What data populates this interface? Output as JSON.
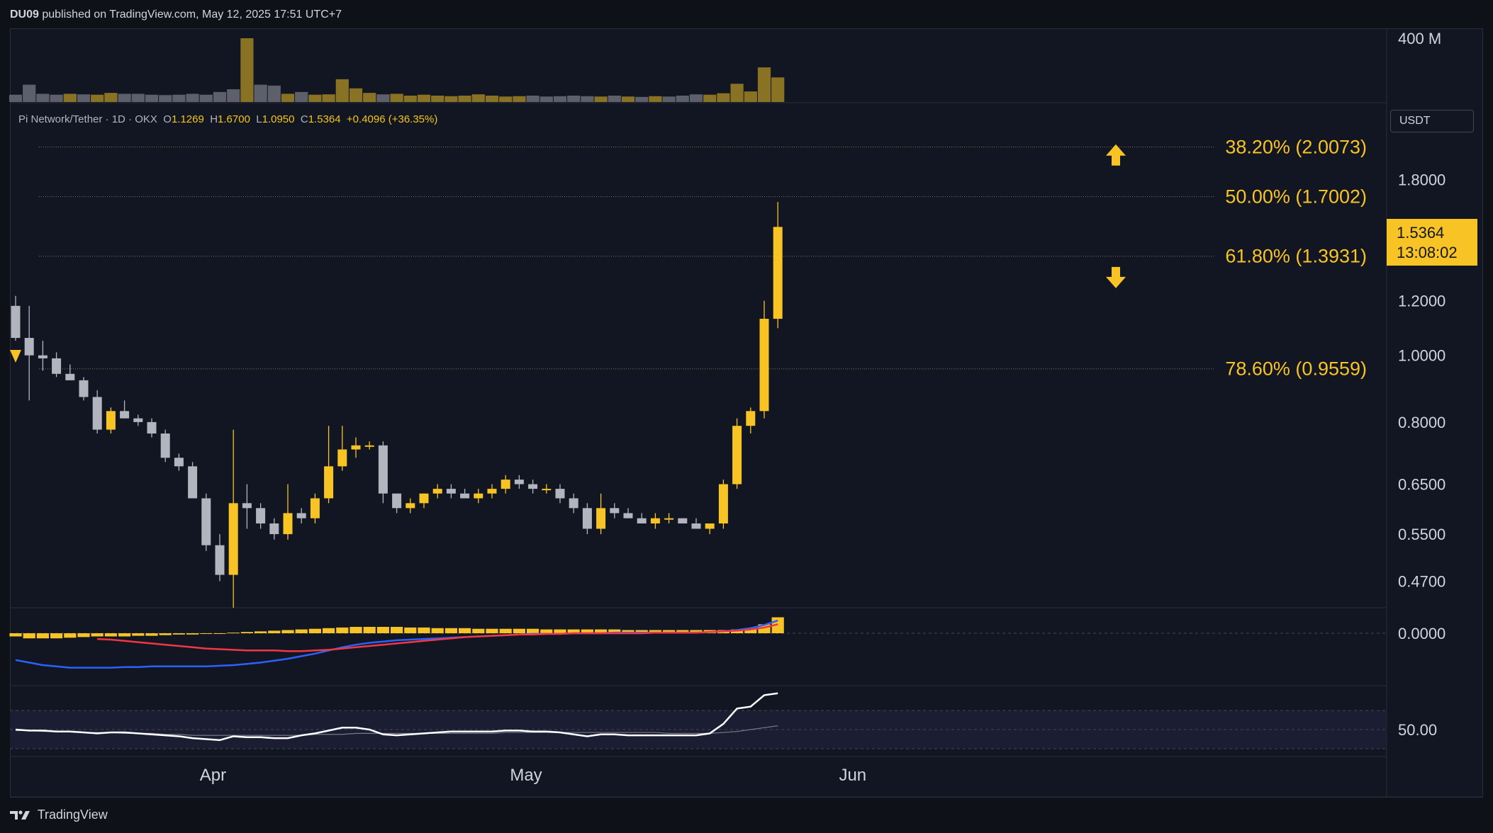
{
  "header": {
    "publisher": "DU09",
    "published_text": "published on TradingView.com, May 12, 2025 17:51 UTC+7"
  },
  "symbol": {
    "name": "Pi Network/Tether",
    "interval": "1D",
    "exchange": "OKX",
    "o_label": "O",
    "o_value": "1.1269",
    "h_label": "H",
    "h_value": "1.6700",
    "l_label": "L",
    "l_value": "1.0950",
    "c_label": "C",
    "c_value": "1.5364",
    "change": "+0.4096 (+36.35%)"
  },
  "currency": "USDT",
  "last_price": {
    "price": "1.5364",
    "countdown": "13:08:02"
  },
  "footer": {
    "brand": "TradingView"
  },
  "colors": {
    "up": "#f7c325",
    "down": "#b2b5be",
    "volume_up": "#8a7224",
    "volume_down": "#5d606b",
    "macd_line": "#2962ff",
    "signal_line": "#f23645",
    "rsi_line": "#ffffff",
    "fib": "#f7c325"
  },
  "chart_data": [
    {
      "type": "candlestick",
      "title": "Pi Network/Tether · 1D · OKX",
      "x_tick_labels": [
        "Apr",
        "May",
        "Jun"
      ],
      "y_scale": "log",
      "y_tick_labels": [
        "1.8000",
        "1.2000",
        "1.0000",
        "0.8000",
        "0.6500",
        "0.5500",
        "0.4700"
      ],
      "y_ticks": [
        1.8,
        1.2,
        1.0,
        0.8,
        0.65,
        0.55,
        0.47
      ],
      "ylim": [
        0.43,
        2.3
      ],
      "fib_levels": [
        {
          "label": "38.20% (2.0073)",
          "value": 2.0073
        },
        {
          "label": "50.00% (1.7002)",
          "value": 1.7002
        },
        {
          "label": "61.80% (1.3931)",
          "value": 1.3931
        },
        {
          "label": "78.60% (0.9559)",
          "value": 0.9559
        }
      ],
      "annotations": [
        {
          "type": "arrow-up",
          "price": 1.95
        },
        {
          "type": "arrow-down",
          "price": 1.3
        }
      ],
      "candles": [
        [
          1.18,
          1.22,
          1.05,
          1.06
        ],
        [
          1.06,
          1.18,
          0.86,
          1.0
        ],
        [
          1.0,
          1.05,
          0.95,
          0.99
        ],
        [
          0.99,
          1.01,
          0.93,
          0.94
        ],
        [
          0.94,
          0.97,
          0.92,
          0.92
        ],
        [
          0.92,
          0.93,
          0.86,
          0.87
        ],
        [
          0.87,
          0.89,
          0.77,
          0.78
        ],
        [
          0.78,
          0.84,
          0.77,
          0.83
        ],
        [
          0.83,
          0.86,
          0.81,
          0.81
        ],
        [
          0.81,
          0.82,
          0.79,
          0.8
        ],
        [
          0.8,
          0.81,
          0.76,
          0.77
        ],
        [
          0.77,
          0.78,
          0.7,
          0.71
        ],
        [
          0.71,
          0.72,
          0.68,
          0.69
        ],
        [
          0.69,
          0.7,
          0.62,
          0.62
        ],
        [
          0.62,
          0.63,
          0.52,
          0.53
        ],
        [
          0.53,
          0.55,
          0.47,
          0.48
        ],
        [
          0.48,
          0.78,
          0.43,
          0.61
        ],
        [
          0.61,
          0.65,
          0.56,
          0.6
        ],
        [
          0.6,
          0.61,
          0.56,
          0.57
        ],
        [
          0.57,
          0.58,
          0.54,
          0.55
        ],
        [
          0.55,
          0.65,
          0.54,
          0.59
        ],
        [
          0.59,
          0.6,
          0.57,
          0.58
        ],
        [
          0.58,
          0.63,
          0.57,
          0.62
        ],
        [
          0.62,
          0.79,
          0.61,
          0.69
        ],
        [
          0.69,
          0.79,
          0.68,
          0.73
        ],
        [
          0.73,
          0.76,
          0.71,
          0.74
        ],
        [
          0.74,
          0.75,
          0.73,
          0.74
        ],
        [
          0.74,
          0.75,
          0.61,
          0.63
        ],
        [
          0.63,
          0.63,
          0.59,
          0.6
        ],
        [
          0.6,
          0.62,
          0.59,
          0.61
        ],
        [
          0.61,
          0.63,
          0.6,
          0.63
        ],
        [
          0.63,
          0.65,
          0.62,
          0.64
        ],
        [
          0.64,
          0.65,
          0.62,
          0.63
        ],
        [
          0.63,
          0.64,
          0.62,
          0.62
        ],
        [
          0.62,
          0.64,
          0.61,
          0.63
        ],
        [
          0.63,
          0.65,
          0.62,
          0.64
        ],
        [
          0.64,
          0.67,
          0.63,
          0.66
        ],
        [
          0.66,
          0.67,
          0.64,
          0.65
        ],
        [
          0.65,
          0.66,
          0.63,
          0.64
        ],
        [
          0.64,
          0.65,
          0.63,
          0.64
        ],
        [
          0.64,
          0.65,
          0.61,
          0.62
        ],
        [
          0.62,
          0.63,
          0.59,
          0.6
        ],
        [
          0.6,
          0.61,
          0.55,
          0.56
        ],
        [
          0.56,
          0.63,
          0.55,
          0.6
        ],
        [
          0.6,
          0.61,
          0.58,
          0.59
        ],
        [
          0.59,
          0.6,
          0.58,
          0.58
        ],
        [
          0.58,
          0.59,
          0.57,
          0.57
        ],
        [
          0.57,
          0.59,
          0.56,
          0.58
        ],
        [
          0.58,
          0.59,
          0.57,
          0.58
        ],
        [
          0.58,
          0.58,
          0.57,
          0.57
        ],
        [
          0.57,
          0.58,
          0.56,
          0.56
        ],
        [
          0.56,
          0.57,
          0.55,
          0.57
        ],
        [
          0.57,
          0.66,
          0.56,
          0.65
        ],
        [
          0.65,
          0.81,
          0.64,
          0.79
        ],
        [
          0.79,
          0.84,
          0.77,
          0.83
        ],
        [
          0.83,
          1.2,
          0.81,
          1.13
        ],
        [
          1.13,
          1.67,
          1.095,
          1.5364
        ]
      ]
    },
    {
      "type": "bar",
      "title": "Volume",
      "y_tick_labels": [
        "400 M"
      ],
      "values": [
        40,
        95,
        45,
        40,
        45,
        42,
        40,
        50,
        45,
        45,
        40,
        38,
        40,
        45,
        40,
        55,
        70,
        350,
        95,
        90,
        45,
        55,
        40,
        42,
        125,
        75,
        50,
        42,
        45,
        35,
        40,
        35,
        32,
        35,
        42,
        35,
        30,
        32,
        35,
        30,
        32,
        35,
        32,
        30,
        35,
        30,
        28,
        32,
        30,
        35,
        42,
        40,
        48,
        100,
        58,
        190,
        135
      ],
      "up": [
        0,
        0,
        0,
        0,
        1,
        0,
        1,
        1,
        0,
        0,
        0,
        0,
        0,
        0,
        0,
        0,
        0,
        1,
        0,
        0,
        1,
        0,
        1,
        1,
        1,
        1,
        1,
        0,
        1,
        1,
        1,
        1,
        1,
        1,
        1,
        1,
        1,
        1,
        0,
        0,
        0,
        0,
        0,
        1,
        0,
        1,
        0,
        1,
        0,
        0,
        0,
        1,
        1,
        1,
        1,
        1,
        1
      ]
    },
    {
      "type": "bar",
      "title": "MACD",
      "y_tick_labels": [
        "0.0000"
      ],
      "histogram": [
        -5,
        -8,
        -8,
        -8,
        -7,
        -6,
        -5,
        -5,
        -5,
        -4,
        -4,
        -3,
        -2,
        -2,
        -1,
        0,
        1,
        2,
        3,
        4,
        5,
        6,
        7,
        8,
        9,
        10,
        10,
        10,
        10,
        9,
        9,
        8,
        8,
        8,
        7,
        7,
        7,
        7,
        7,
        6,
        6,
        6,
        6,
        6,
        6,
        5,
        5,
        5,
        5,
        5,
        5,
        5,
        5,
        6,
        8,
        14,
        25
      ],
      "series": [
        {
          "values": [
            -42,
            -46,
            -50,
            -52,
            -54,
            -54,
            -54,
            -54,
            -53,
            -53,
            -52,
            -52,
            -52,
            -52,
            -52,
            -51,
            -50,
            -48,
            -46,
            -43,
            -40,
            -36,
            -32,
            -27,
            -22,
            -18,
            -15,
            -13,
            -11,
            -10,
            -9,
            -8,
            -7,
            -6,
            -5,
            -4,
            -3,
            -2,
            -1,
            -1,
            -1,
            0,
            0,
            0,
            1,
            1,
            1,
            1,
            1,
            1,
            1,
            2,
            3,
            5,
            8,
            13,
            20
          ]
        },
        {
          "values": [
            null,
            null,
            null,
            null,
            null,
            null,
            -9,
            -10,
            -12,
            -14,
            -16,
            -18,
            -20,
            -22,
            -24,
            -25,
            -26,
            -27,
            -27,
            -27,
            -28,
            -28,
            -27,
            -26,
            -24,
            -22,
            -20,
            -18,
            -16,
            -14,
            -12,
            -10,
            -8,
            -6,
            -5,
            -4,
            -3,
            -2,
            -2,
            -1,
            -1,
            0,
            0,
            0,
            0,
            0,
            0,
            1,
            1,
            1,
            1,
            2,
            3,
            4,
            6,
            9,
            14
          ]
        }
      ]
    },
    {
      "type": "line",
      "title": "RSI",
      "y_tick_labels": [
        "50.00"
      ],
      "series": [
        {
          "values": [
            50,
            49,
            49,
            48,
            48,
            47,
            46,
            47,
            47,
            46,
            45,
            44,
            43,
            41,
            40,
            39,
            43,
            42,
            42,
            41,
            41,
            44,
            46,
            49,
            52,
            52,
            50,
            45,
            44,
            45,
            46,
            47,
            48,
            48,
            48,
            48,
            49,
            49,
            48,
            48,
            47,
            45,
            43,
            45,
            45,
            44,
            44,
            44,
            44,
            44,
            44,
            46,
            56,
            72,
            74,
            86,
            88
          ]
        },
        {
          "values": [
            49,
            49,
            48,
            48,
            48,
            47,
            47,
            47,
            46,
            46,
            46,
            45,
            45,
            44,
            44,
            44,
            44,
            44,
            44,
            44,
            44,
            44,
            45,
            45,
            45,
            46,
            46,
            46,
            46,
            46,
            46,
            46,
            46,
            46,
            46,
            46,
            47,
            47,
            47,
            47,
            47,
            47,
            47,
            47,
            47,
            47,
            47,
            47,
            46,
            46,
            46,
            46,
            47,
            48,
            50,
            52,
            54
          ]
        }
      ]
    }
  ]
}
